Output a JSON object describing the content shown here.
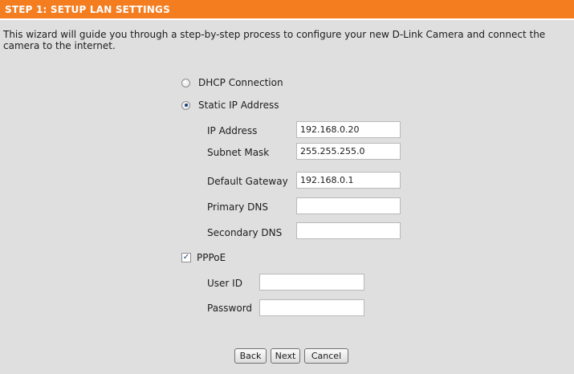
{
  "header": {
    "title": "STEP 1: SETUP LAN SETTINGS"
  },
  "intro": {
    "text": "This wizard will guide you through a step-by-step process to configure your new D-Link Camera and connect the camera to the internet."
  },
  "connection": {
    "dhcp_label": "DHCP Connection",
    "static_label": "Static IP Address",
    "selected": "Static IP Address"
  },
  "static_ip": {
    "ip_address": {
      "label": "IP Address",
      "value": "192.168.0.20"
    },
    "subnet_mask": {
      "label": "Subnet Mask",
      "value": "255.255.255.0"
    },
    "default_gateway": {
      "label": "Default Gateway",
      "value": "192.168.0.1"
    },
    "primary_dns": {
      "label": "Primary DNS",
      "value": ""
    },
    "secondary_dns": {
      "label": "Secondary DNS",
      "value": ""
    }
  },
  "pppoe": {
    "label": "PPPoE",
    "checked": true,
    "user_id": {
      "label": "User ID",
      "value": ""
    },
    "password": {
      "label": "Password",
      "value": ""
    }
  },
  "buttons": {
    "back": "Back",
    "next": "Next",
    "cancel": "Cancel"
  },
  "colors": {
    "header_bg": "#f47d20",
    "panel_bg": "#dfdfdf",
    "header_text": "#ffffff"
  }
}
